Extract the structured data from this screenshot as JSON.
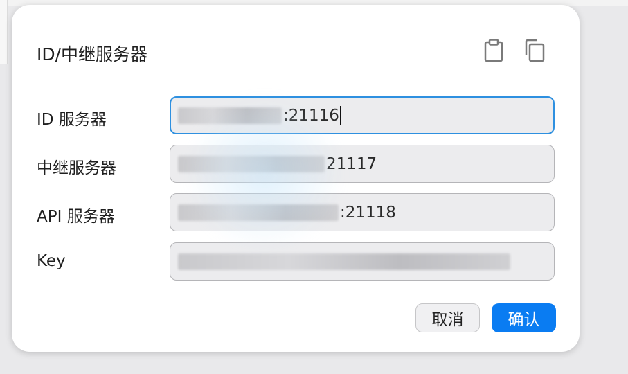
{
  "dialog": {
    "title": "ID/中继服务器",
    "icons": {
      "paste": "clipboard-icon",
      "copy": "copy-icon"
    },
    "fields": [
      {
        "label": "ID 服务器",
        "value_suffix": ":21116",
        "focused": true
      },
      {
        "label": "中继服务器",
        "value_suffix": "21117",
        "focused": false
      },
      {
        "label": "API 服务器",
        "value_suffix": ":21118",
        "focused": false
      },
      {
        "label": "Key",
        "value_suffix": "",
        "focused": false
      }
    ],
    "buttons": {
      "cancel": "取消",
      "ok": "确认"
    },
    "colors": {
      "accent": "#0a7cf2",
      "focus_border": "#2e90e0",
      "field_bg": "#ececee"
    }
  }
}
